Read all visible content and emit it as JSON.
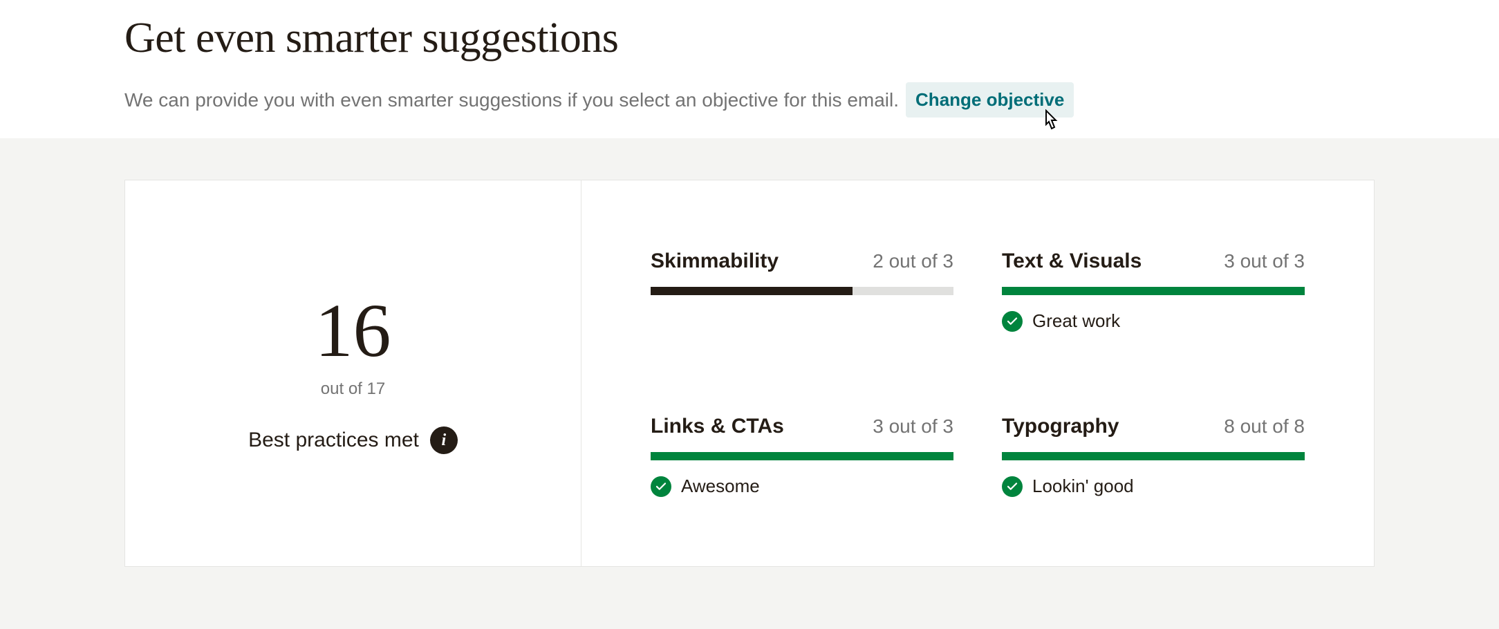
{
  "header": {
    "title": "Get even smarter suggestions",
    "subtitle": "We can provide you with even smarter suggestions if you select an objective for this email.",
    "change_link": "Change objective"
  },
  "summary": {
    "score": "16",
    "out_of": "out of 17",
    "label": "Best practices met"
  },
  "metrics": {
    "skimmability": {
      "title": "Skimmability",
      "score": "2 out of 3",
      "fill_pct": 66.7,
      "color": "black"
    },
    "text_visuals": {
      "title": "Text & Visuals",
      "score": "3 out of 3",
      "fill_pct": 100,
      "color": "green",
      "footer": "Great work"
    },
    "links_ctas": {
      "title": "Links & CTAs",
      "score": "3 out of 3",
      "fill_pct": 100,
      "color": "green",
      "footer": "Awesome"
    },
    "typography": {
      "title": "Typography",
      "score": "8 out of 8",
      "fill_pct": 100,
      "color": "green",
      "footer": "Lookin' good"
    }
  }
}
